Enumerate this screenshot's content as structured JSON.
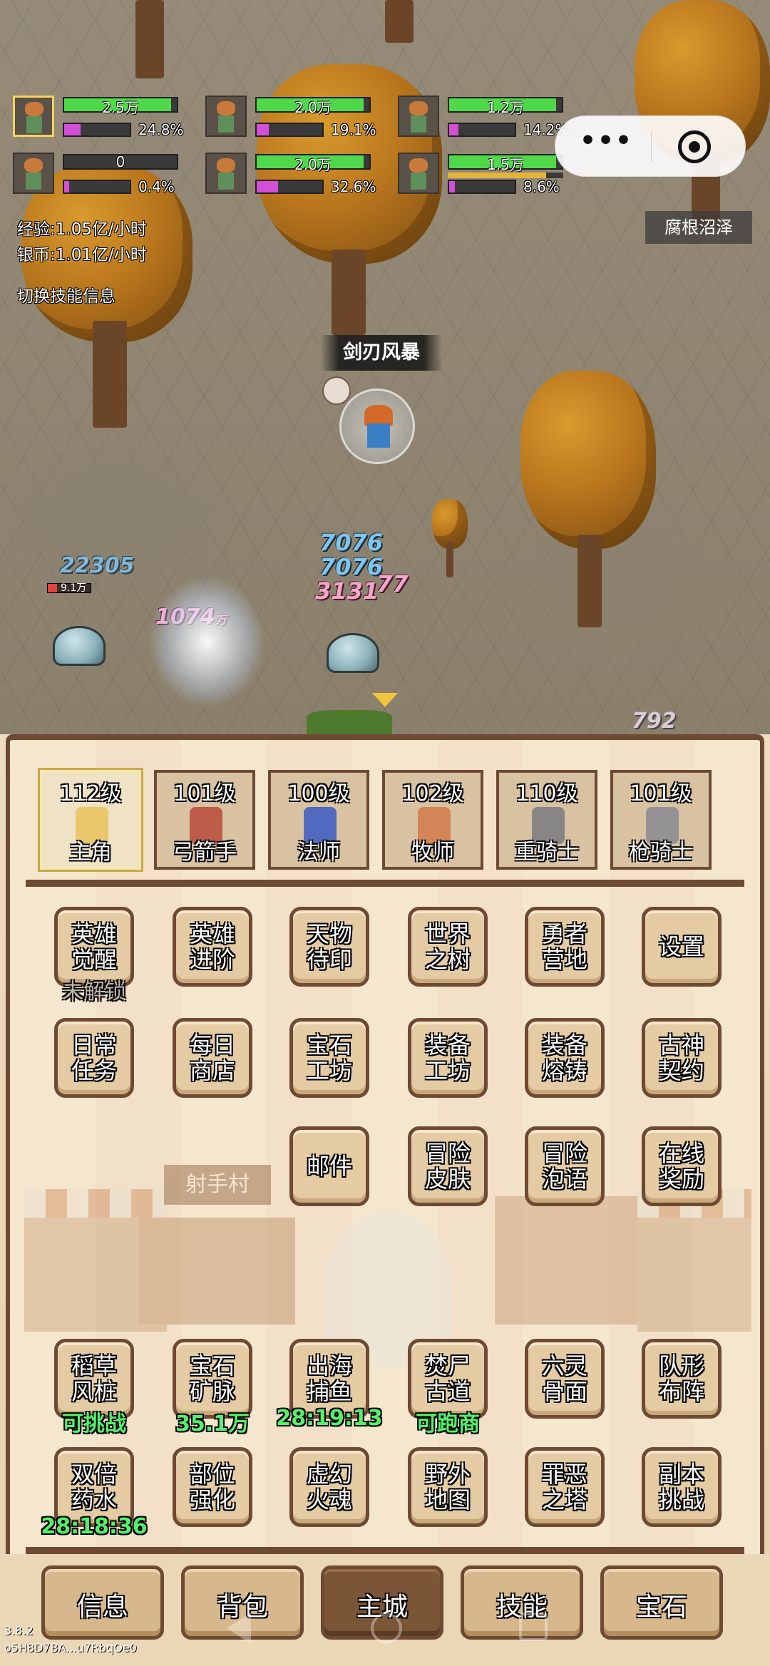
{
  "party_hud": [
    {
      "icon": "hero-portrait-icon",
      "hp": "2.5万",
      "hp_fill": 0.95,
      "exp_pct": "24.8%",
      "exp_fill": 0.25,
      "selected": true
    },
    {
      "icon": "archer-portrait-icon",
      "hp": "2.0万",
      "hp_fill": 0.95,
      "exp_pct": "19.1%",
      "exp_fill": 0.19
    },
    {
      "icon": "mage-portrait-icon",
      "hp": "1.2万",
      "hp_fill": 0.95,
      "exp_pct": "14.2%",
      "exp_fill": 0.14
    },
    {
      "icon": "priest-portrait-icon",
      "hp": "0",
      "hp_fill": 0,
      "exp_pct": "0.4%",
      "exp_fill": 0.01
    },
    {
      "icon": "heavy-knight-portrait-icon",
      "hp": "2.0万",
      "hp_fill": 0.95,
      "exp_pct": "32.6%",
      "exp_fill": 0.33
    },
    {
      "icon": "lancer-portrait-icon",
      "hp": "1.5万",
      "hp_fill": 0.95,
      "exp_pct": "8.6%",
      "exp_fill": 0.09,
      "mana_fill": 0.85
    }
  ],
  "stats": {
    "exp_rate": "经验:1.05亿/小时",
    "silver_rate": "银币:1.01亿/小时",
    "toggle_skill": "切换技能信息"
  },
  "map_name": "腐根沼泽",
  "skill_banner": "剑刃风暴",
  "damage_numbers": {
    "d1": "7076",
    "d2": "7076",
    "d3": "3131",
    "d4": "77",
    "d5": "22305",
    "d6": "1074",
    "d6_unit": "万",
    "d7": "792",
    "enemy_hp": "9.1万"
  },
  "heroes": [
    {
      "level": "112级",
      "name": "主角",
      "active": true
    },
    {
      "level": "101级",
      "name": "弓箭手"
    },
    {
      "level": "100级",
      "name": "法师"
    },
    {
      "level": "102级",
      "name": "牧师"
    },
    {
      "level": "110级",
      "name": "重骑士"
    },
    {
      "level": "101级",
      "name": "枪骑士"
    }
  ],
  "menu_row1": [
    "英雄\n觉醒",
    "英雄\n进阶",
    "天物\n待印",
    "世界\n之树",
    "勇者\n营地",
    "设置"
  ],
  "menu_row1_sub": "未解锁",
  "menu_row2": [
    "日常\n任务",
    "每日\n商店",
    "宝石\n工坊",
    "装备\n工坊",
    "装备\n熔铸",
    "古神\n契约"
  ],
  "menu_row3": [
    "邮件",
    "冒险\n皮肤",
    "冒险\n泡语",
    "在线\n奖励"
  ],
  "village_sign": "射手村",
  "activity_row1": [
    "稻草\n风桩",
    "宝石\n矿脉",
    "出海\n捕鱼",
    "焚尸\n古道",
    "六灵\n骨面",
    "队形\n布阵"
  ],
  "activity_row1_sub": [
    "可挑战",
    "35.1万",
    "28:19:13",
    "可跑商"
  ],
  "activity_row2": [
    "双倍\n药水",
    "部位\n强化",
    "虚幻\n火魂",
    "野外\n地图",
    "罪恶\n之塔",
    "副本\n挑战"
  ],
  "activity_row2_sub": "28:18:36",
  "tabs": [
    "信息",
    "背包",
    "主城",
    "技能",
    "宝石"
  ],
  "active_tab": "主城",
  "version": "3.8.2",
  "build_id": "o5H8D7BA...u7RbqOe0",
  "colors": {
    "hp": "#4fd84a",
    "exp": "#d24fd8",
    "mana": "#e3b43a",
    "frame": "#6e4a32",
    "sub_green": "#55f06a"
  }
}
